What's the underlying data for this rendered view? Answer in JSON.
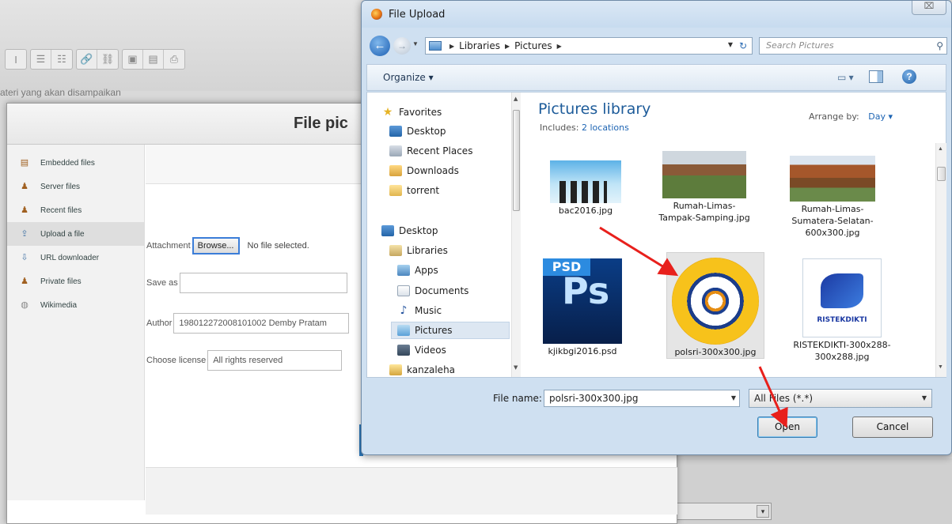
{
  "editor": {
    "toolbar": [
      "I",
      "☰",
      "☷",
      "🔗",
      "⛓",
      "▣",
      "▤",
      "⎙"
    ],
    "body_text": "ateri yang akan disampaikan"
  },
  "file_picker": {
    "title": "File pic",
    "repositories": [
      {
        "label": "Embedded files",
        "icon": "file-icon"
      },
      {
        "label": "Server files",
        "icon": "server-icon"
      },
      {
        "label": "Recent files",
        "icon": "recent-icon"
      },
      {
        "label": "Upload a file",
        "icon": "upload-icon",
        "active": true
      },
      {
        "label": "URL downloader",
        "icon": "url-icon"
      },
      {
        "label": "Private files",
        "icon": "private-icon"
      },
      {
        "label": "Wikimedia",
        "icon": "wikimedia-icon"
      }
    ],
    "attachment_label": "Attachment",
    "browse_label": "Browse...",
    "no_file_text": "No file selected.",
    "save_as_label": "Save as",
    "save_as_value": "",
    "author_label": "Author",
    "author_value": "198012272008101002 Demby Pratam",
    "license_label": "Choose license",
    "license_value": "All rights reserved"
  },
  "dialog": {
    "title": "File Upload",
    "close_symbol": "⌧",
    "breadcrumb": [
      "Libraries",
      "Pictures"
    ],
    "search_placeholder": "Search Pictures",
    "organize_label": "Organize ▾",
    "nav_favorites": [
      {
        "label": "Favorites",
        "icon": "star-icon"
      },
      {
        "label": "Desktop",
        "icon": "desktop-icon"
      },
      {
        "label": "Recent Places",
        "icon": "recent-places-icon"
      },
      {
        "label": "Downloads",
        "icon": "downloads-icon"
      },
      {
        "label": "torrent",
        "icon": "folder-icon"
      }
    ],
    "nav_tree": [
      {
        "label": "Desktop",
        "icon": "desktop-icon"
      },
      {
        "label": "Libraries",
        "icon": "libraries-icon"
      },
      {
        "label": "Apps",
        "icon": "apps-icon"
      },
      {
        "label": "Documents",
        "icon": "documents-icon"
      },
      {
        "label": "Music",
        "icon": "music-icon"
      },
      {
        "label": "Pictures",
        "icon": "pictures-icon",
        "selected": true
      },
      {
        "label": "Videos",
        "icon": "videos-icon"
      },
      {
        "label": "kanzaleha",
        "icon": "user-folder-icon"
      }
    ],
    "library_title": "Pictures library",
    "includes_label": "Includes:",
    "includes_link": "2 locations",
    "arrange_label": "Arrange by:",
    "arrange_value": "Day ▾",
    "files": [
      {
        "name": "bac2016.jpg"
      },
      {
        "name": "Rumah-Limas-Tampak-Samping.jpg"
      },
      {
        "name": "Rumah-Limas-Sumatera-Selatan-600x300.jpg"
      },
      {
        "name": "kjikbgi2016.psd"
      },
      {
        "name": "polsri-300x300.jpg",
        "selected": true
      },
      {
        "name": "RISTEKDIKTI-300x288-300x288.jpg"
      }
    ],
    "psd_badge": "PSD",
    "psd_letters": "Ps",
    "filename_label": "File name:",
    "filename_value": "polsri-300x300.jpg",
    "filetype_value": "All Files (*.*)",
    "open_label": "Open",
    "cancel_label": "Cancel"
  },
  "annotation": {
    "arrow_color": "#e8201c"
  }
}
